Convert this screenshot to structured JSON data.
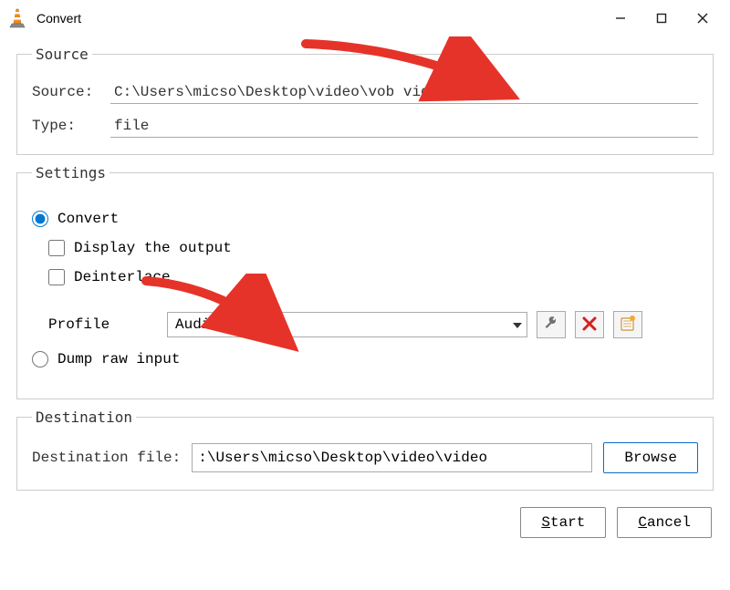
{
  "title": "Convert",
  "source": {
    "legend": "Source",
    "sourceLabel": "Source:",
    "sourceValue": "C:\\Users\\micso\\Desktop\\video\\vob video.vob",
    "typeLabel": "Type:",
    "typeValue": "file"
  },
  "settings": {
    "legend": "Settings",
    "convertLabel": "Convert",
    "displayOutputLabel": "Display the output",
    "deinterlaceLabel": "Deinterlace",
    "profileLabel": "Profile",
    "profileValue": "Audio - MP3",
    "dumpRawLabel": "Dump raw input"
  },
  "destination": {
    "legend": "Destination",
    "fileLabel": "Destination file:",
    "fileValue": ":\\Users\\micso\\Desktop\\video\\video",
    "browseLabel": "Browse"
  },
  "actions": {
    "start": "Start",
    "cancel": "Cancel"
  },
  "icons": {
    "wrench": "wrench-icon",
    "delete": "delete-icon",
    "newProfile": "new-profile-icon"
  }
}
